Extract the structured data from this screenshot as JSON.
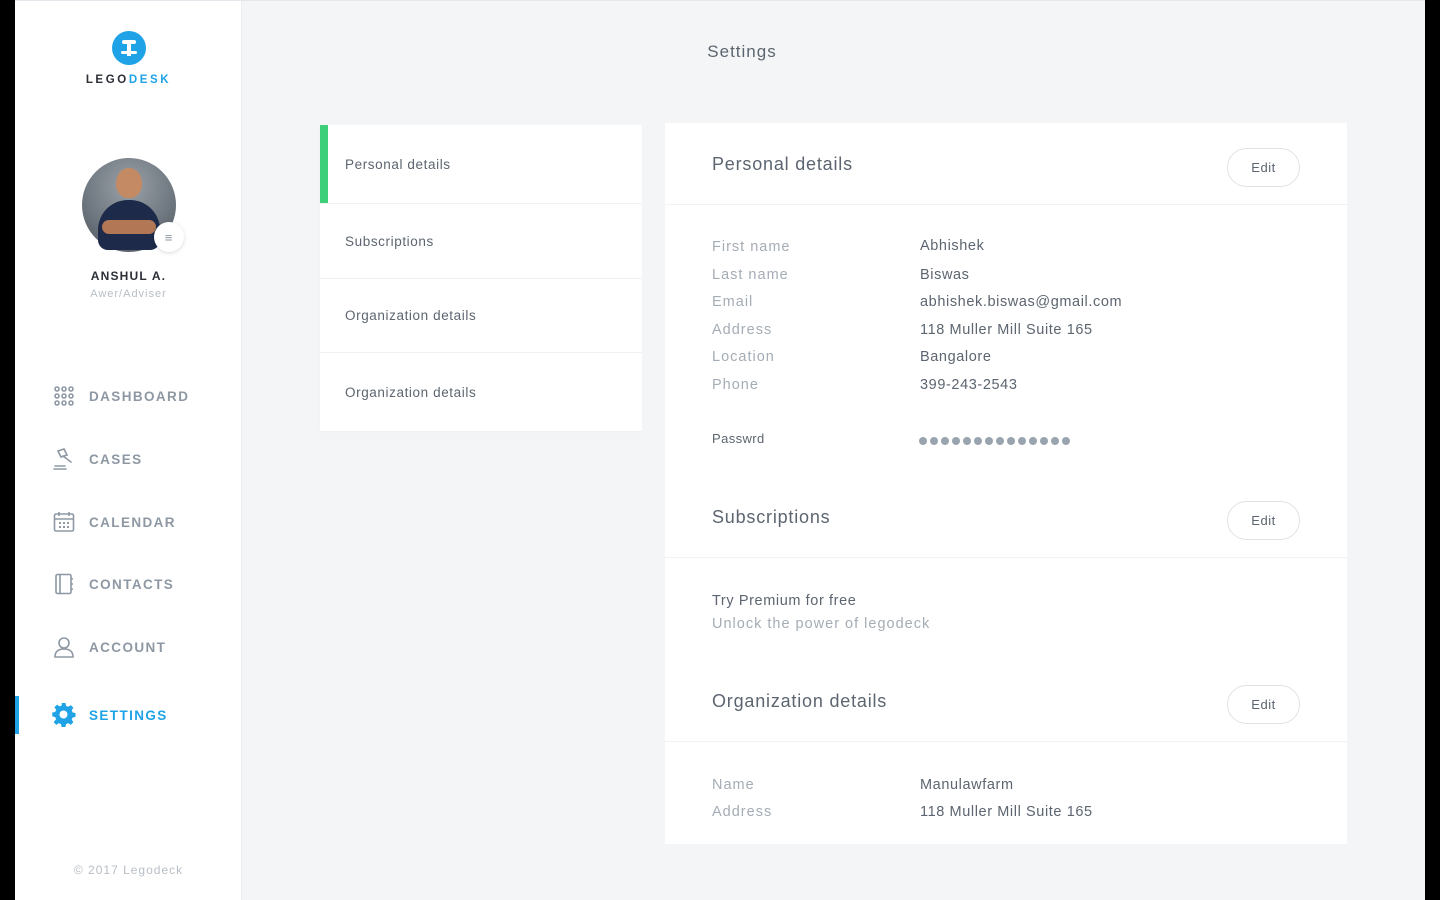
{
  "brand": {
    "part1": "LEGO",
    "part2": "DESK"
  },
  "profile": {
    "name": "ANSHUL A.",
    "role": "Awer/Adviser"
  },
  "nav": {
    "items": [
      {
        "label": "DASHBOARD",
        "icon": "grid-icon"
      },
      {
        "label": "CASES",
        "icon": "gavel-icon"
      },
      {
        "label": "CALENDAR",
        "icon": "calendar-icon"
      },
      {
        "label": "CONTACTS",
        "icon": "contacts-book-icon"
      },
      {
        "label": "ACCOUNT",
        "icon": "user-icon"
      },
      {
        "label": "SETTINGS",
        "icon": "gear-icon",
        "active": true
      }
    ]
  },
  "copyright": "© 2017 Legodeck",
  "page": {
    "title": "Settings"
  },
  "tabs": [
    {
      "label": "Personal details",
      "active": true
    },
    {
      "label": "Subscriptions"
    },
    {
      "label": "Organization details"
    },
    {
      "label": "Organization details"
    }
  ],
  "personal": {
    "title": "Personal details",
    "edit_label": "Edit",
    "fields": [
      {
        "label": "First name",
        "value": "Abhishek"
      },
      {
        "label": "Last name",
        "value": "Biswas"
      },
      {
        "label": "Email",
        "value": "abhishek.biswas@gmail.com"
      },
      {
        "label": "Address",
        "value": "118 Muller Mill Suite 165"
      },
      {
        "label": "Location",
        "value": "Bangalore"
      },
      {
        "label": "Phone",
        "value": "399-243-2543"
      }
    ],
    "password_label": "Passwrd"
  },
  "subscriptions": {
    "title": "Subscriptions",
    "edit_label": "Edit",
    "promo_title": "Try Premium for free",
    "promo_sub": "Unlock the power of legodeck"
  },
  "organization": {
    "title": "Organization details",
    "edit_label": "Edit",
    "fields": [
      {
        "label": "Name",
        "value": "Manulawfarm"
      },
      {
        "label": "Address",
        "value": "118 Muller Mill Suite 165"
      }
    ]
  },
  "colors": {
    "accent": "#1fa3e6",
    "active_tab": "#3ecf7a",
    "muted": "#a4acb5"
  }
}
